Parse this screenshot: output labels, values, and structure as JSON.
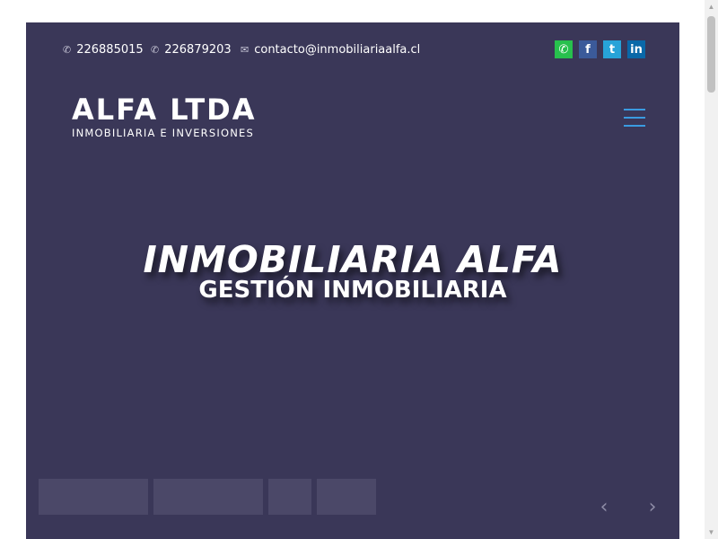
{
  "topbar": {
    "phone1": "226885015",
    "phone2": "226879203",
    "email": "contacto@inmobiliariaalfa.cl",
    "socials": [
      {
        "name": "whatsapp",
        "glyph": "✆",
        "color": "#27c04d"
      },
      {
        "name": "facebook",
        "glyph": "f",
        "color": "#3b5a9a"
      },
      {
        "name": "twitter",
        "glyph": "t",
        "color": "#27a3d8"
      },
      {
        "name": "linkedin",
        "glyph": "in",
        "color": "#0a68a8"
      }
    ]
  },
  "logo": {
    "title": "ALFA LTDA",
    "subtitle": "INMOBILIARIA E INVERSIONES"
  },
  "hero": {
    "title": "INMOBILIARIA ALFA",
    "subtitle": "GESTIÓN INMOBILIARIA"
  },
  "slider": {
    "prev_icon": "‹",
    "next_icon": "›"
  },
  "colors": {
    "background": "#3a3758",
    "menu_accent": "#3a9be0"
  }
}
